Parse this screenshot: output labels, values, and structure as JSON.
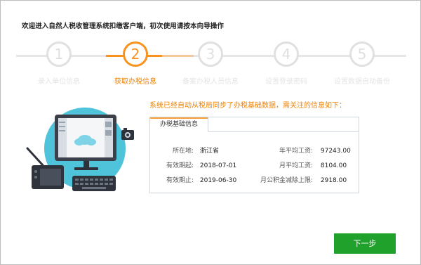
{
  "window": {
    "title": "欢迎进入自然人税收管理系统扣缴客户端，初次使用请按本向导操作"
  },
  "steps": [
    {
      "number": "1",
      "label": "录入单位信息",
      "state": "done"
    },
    {
      "number": "2",
      "label": "获取办税信息",
      "state": "active"
    },
    {
      "number": "3",
      "label": "备案办税人员信息",
      "state": "pending"
    },
    {
      "number": "4",
      "label": "设置登录密码",
      "state": "pending"
    },
    {
      "number": "5",
      "label": "设置数据自动备份",
      "state": "pending"
    }
  ],
  "notice": "系统已经自动从税局同步了办税基础数据，需关注的信息如下：",
  "panel": {
    "tab_label": "办税基础信息",
    "left": [
      {
        "key": "所在地:",
        "value": "浙江省"
      },
      {
        "key": "有效期起:",
        "value": "2018-07-01"
      },
      {
        "key": "有效期止:",
        "value": "2019-06-30"
      }
    ],
    "right": [
      {
        "key": "年平均工资:",
        "value": "97243.00"
      },
      {
        "key": "月平均工资:",
        "value": "8104.00"
      },
      {
        "key": "月公积金减除上限:",
        "value": "2918.00"
      }
    ]
  },
  "buttons": {
    "next_label": "下一步"
  },
  "colors": {
    "accent": "#f7931e",
    "primary_button": "#1fa12c",
    "inactive": "#e0e0e0"
  },
  "illustration": {
    "icons": [
      "desktop-monitor-icon",
      "cloud-icon",
      "camera-icon",
      "keyboard-icon",
      "drawing-tablet-icon",
      "stylus-pen-icon"
    ]
  }
}
